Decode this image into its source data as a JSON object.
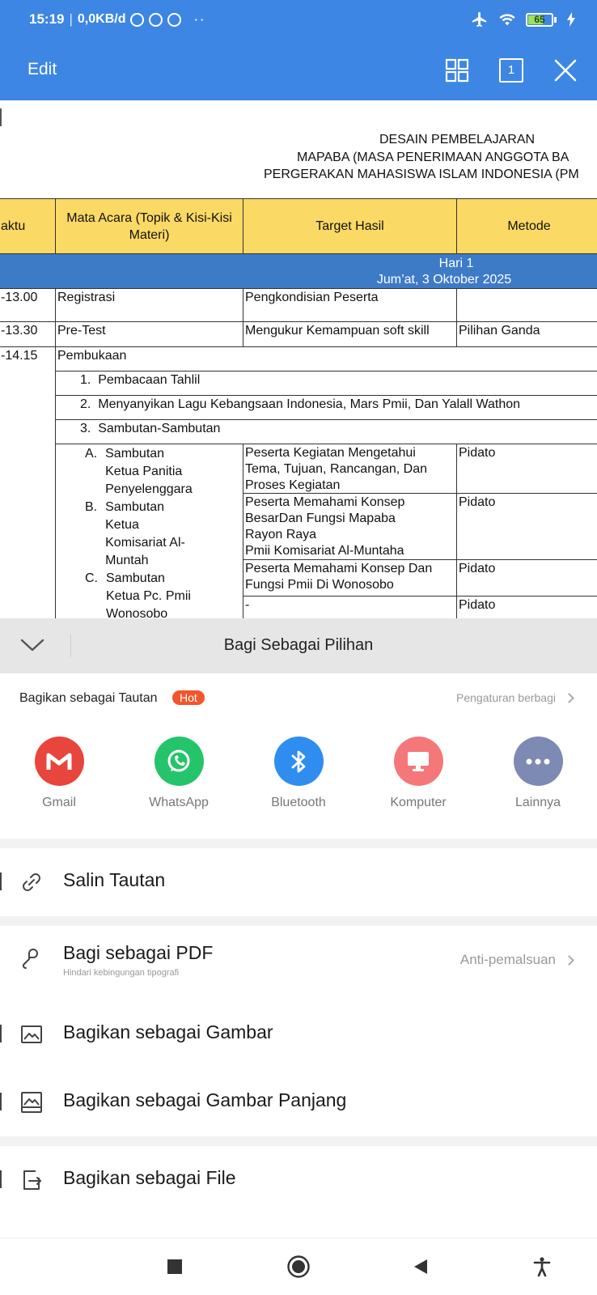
{
  "status_bar": {
    "time": "15:19",
    "separator": "|",
    "net_speed": "0,0KB/d",
    "dots": "··",
    "battery_level": "65",
    "battery_percent": 0.65
  },
  "app_bar": {
    "edit_label": "Edit",
    "page_number": "1"
  },
  "document": {
    "title_lines": [
      "DESAIN PEMBELAJARAN",
      "MAPABA (MASA PENERIMAAN ANGGOTA BA",
      "PERGERAKAN MAHASISWA ISLAM INDONESIA (PM"
    ],
    "headers": {
      "waktu": "aktu",
      "mata_acara": "Mata Acara (Topik & Kisi-Kisi Materi)",
      "target": "Target Hasil",
      "metode": "Metode"
    },
    "day": {
      "label": "Hari 1",
      "date": "Jum’at, 3 Oktober 2025"
    },
    "rows": {
      "r1": {
        "time": "-13.00",
        "acara": "Registrasi",
        "target": "Pengkondisian Peserta",
        "metode": ""
      },
      "r2": {
        "time": "-13.30",
        "acara": "Pre-Test",
        "target": "Mengukur Kemampuan soft skill",
        "metode": "Pilihan Ganda"
      },
      "r3": {
        "time": "-14.15",
        "acara": "Pembukaan"
      }
    },
    "numbered": [
      {
        "num": "1.",
        "text": "Pembacaan Tahlil"
      },
      {
        "num": "2.",
        "text": "Menyanyikan Lagu Kebangsaan Indonesia, Mars Pmii, Dan Yalall Wathon"
      },
      {
        "num": "3.",
        "text": "Sambutan-Sambutan"
      }
    ],
    "sub_items": {
      "a_letter": "A.",
      "a_l1": "Sambutan",
      "a_l2": "Ketua Panitia",
      "a_l3": "Penyelenggara",
      "b_letter": "B.",
      "b_l1": "Sambutan",
      "b_l2": "Ketua",
      "b_l3": "Komisariat Al-",
      "b_l4": "Muntah",
      "c_letter": "C.",
      "c_l1": "Sambutan",
      "c_l2": "Ketua Pc. Pmii",
      "c_l3": "Wonosobo"
    },
    "targets": {
      "t1_l1": "Peserta Kegiatan Mengetahui",
      "t1_l2": "Tema, Tujuan, Rancangan, Dan",
      "t1_l3": "Proses Kegiatan",
      "t2_l1": "Peserta Memahami Konsep",
      "t2_l2": "BesarDan Fungsi Mapaba",
      "t2_l3": "Rayon Raya",
      "t2_l4": "Pmii Komisariat Al-Muntaha",
      "t3_l1": "Peserta Memahami Konsep Dan",
      "t3_l2": "Fungsi Pmii Di Wonosobo",
      "t4_l1": "-"
    },
    "methods": {
      "m1": "Pidato",
      "m2": "Pidato",
      "m3": "Pidato",
      "m4": "Pidato"
    }
  },
  "share_sheet": {
    "title": "Bagi Sebagai Pilihan",
    "link_label": "Bagikan sebagai Tautan",
    "hot_badge": "Hot",
    "settings_label": "Pengaturan berbagi",
    "apps": {
      "gmail": "Gmail",
      "whatsapp": "WhatsApp",
      "bluetooth": "Bluetooth",
      "komputer": "Komputer",
      "lainnya": "Lainnya"
    },
    "options": {
      "copy_link": "Salin Tautan",
      "pdf": "Bagi sebagai PDF",
      "pdf_sub": "Hindari kebingungan tipografi",
      "pdf_right": "Anti-pemalsuan",
      "image": "Bagikan sebagai Gambar",
      "long_image": "Bagikan sebagai Gambar Panjang",
      "file": "Bagikan sebagai File"
    }
  },
  "colors": {
    "app_bar": "#3d86e3",
    "table_header": "#fbd965",
    "day_band": "#3e7bc7",
    "hot_badge": "#f0552b",
    "gmail": "#e8453c",
    "whatsapp": "#25c46b",
    "bluetooth": "#2f8df0",
    "komputer": "#f4787a",
    "lainnya": "#7d8ab3"
  },
  "icons": {
    "grid": "grid-icon",
    "page": "page-number-icon",
    "close": "close-icon",
    "collapse": "chevron-down-icon",
    "link": "link-icon",
    "pdf": "pdf-icon",
    "image": "image-icon",
    "long_image": "long-image-icon",
    "file": "file-export-icon"
  }
}
